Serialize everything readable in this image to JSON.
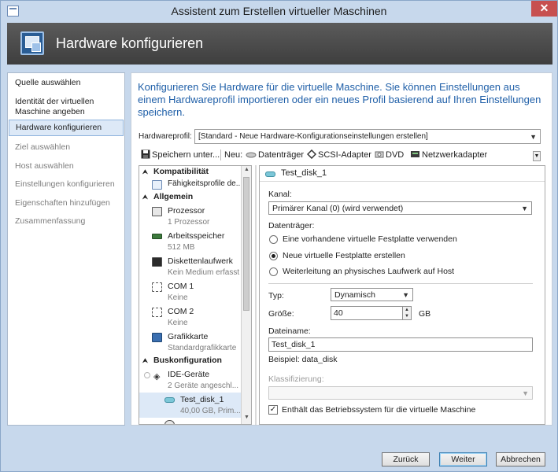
{
  "window": {
    "title": "Assistent zum Erstellen virtueller Maschinen",
    "close_glyph": "✕"
  },
  "banner": {
    "title": "Hardware konfigurieren",
    "icon": "hardware-wizard-icon"
  },
  "nav": {
    "items": [
      {
        "label": "Quelle auswählen",
        "state": "normal"
      },
      {
        "label": "Identität der virtuellen Maschine angeben",
        "state": "normal"
      },
      {
        "label": "Hardware konfigurieren",
        "state": "active"
      },
      {
        "label": "Ziel auswählen",
        "state": "disabled"
      },
      {
        "label": "Host auswählen",
        "state": "disabled"
      },
      {
        "label": "Einstellungen konfigurieren",
        "state": "disabled"
      },
      {
        "label": "Eigenschaften hinzufügen",
        "state": "disabled"
      },
      {
        "label": "Zusammenfassung",
        "state": "disabled"
      }
    ]
  },
  "main": {
    "intro": "Konfigurieren Sie Hardware für die virtuelle Maschine. Sie können Einstellungen aus einem Hardwareprofil importieren oder ein neues Profil basierend auf Ihren Einstellungen speichern.",
    "hwprofile_label": "Hardwareprofil:",
    "hwprofile_value": "[Standard - Neue Hardware-Konfigurationseinstellungen erstellen]"
  },
  "toolbar": {
    "save": "Speichern unter...",
    "new_label": "Neu:",
    "disk": "Datenträger",
    "scsi": "SCSI-Adapter",
    "dvd": "DVD",
    "nic": "Netzwerkadapter"
  },
  "tree": {
    "sec_compat": "Kompatibilität",
    "compat_item": "Fähigkeitsprofile de...",
    "sec_general": "Allgemein",
    "cpu_title": "Prozessor",
    "cpu_sub": "1 Prozessor",
    "ram_title": "Arbeitsspeicher",
    "ram_sub": "512 MB",
    "floppy_title": "Diskettenlaufwerk",
    "floppy_sub": "Kein Medium erfasst",
    "com1_title": "COM 1",
    "com1_sub": "Keine",
    "com2_title": "COM 2",
    "com2_sub": "Keine",
    "gpu_title": "Grafikkarte",
    "gpu_sub": "Standardgrafikkarte",
    "sec_bus": "Buskonfiguration",
    "ide_title": "IDE-Geräte",
    "ide_sub": "2 Geräte angeschl...",
    "vhd_title": "Test_disk_1",
    "vhd_sub": "40,00 GB, Prim..."
  },
  "detail": {
    "header": "Test_disk_1",
    "channel_label": "Kanal:",
    "channel_value": "Primärer Kanal (0) (wird verwendet)",
    "disk_group_label": "Datenträger:",
    "opt_existing": "Eine vorhandene virtuelle Festplatte verwenden",
    "opt_new": "Neue virtuelle Festplatte erstellen",
    "opt_passthrough": "Weiterleitung an physisches Laufwerk auf Host",
    "type_label": "Typ:",
    "type_value": "Dynamisch",
    "size_label": "Größe:",
    "size_value": "40",
    "size_unit": "GB",
    "filename_label": "Dateiname:",
    "filename_value": "Test_disk_1",
    "example": "Beispiel: data_disk",
    "class_label": "Klassifizierung:",
    "class_value": "",
    "os_checkbox": "Enthält das Betriebssystem für die virtuelle Maschine",
    "os_checkbox_checked": true
  },
  "buttons": {
    "back": "Zurück",
    "next": "Weiter",
    "cancel": "Abbrechen"
  }
}
